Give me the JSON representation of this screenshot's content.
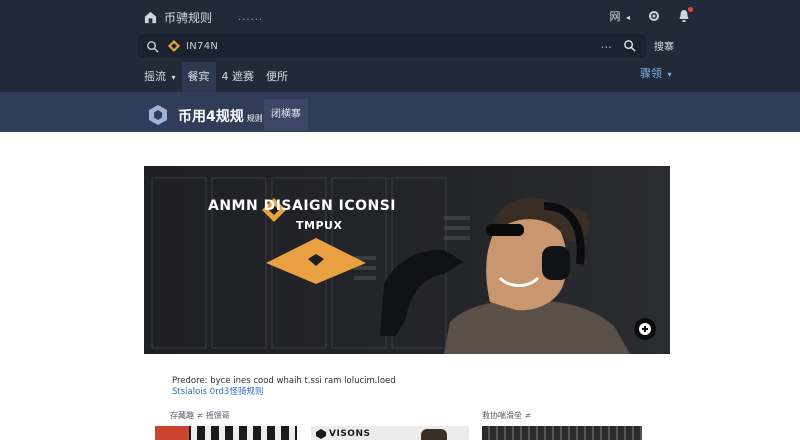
{
  "header": {
    "site_name": "币骋规则",
    "site_dots": "......",
    "lang_label": "网",
    "lang_caret": "◂",
    "search_query": "IN74N",
    "search_dots": "...",
    "search_button": "搜寨"
  },
  "nav": {
    "items": [
      {
        "label": "摇流",
        "caret": "▾"
      },
      {
        "label": "餐宾"
      },
      {
        "label": "4 遮赛"
      },
      {
        "label": "便所"
      }
    ],
    "right_label": "骤领",
    "right_caret": "▾"
  },
  "banner": {
    "title": "币用4规规",
    "subtitle": "规则",
    "button": "闭横寨"
  },
  "hero": {
    "title": "ANMN   DISAIGN ICONSI",
    "subtitle": "TMPUX"
  },
  "desc": {
    "line1": "Predore:  byce ines  cood whaih t.ssi ram lolucim.loed",
    "line2": "Stsialois 0rd3怪骑规则"
  },
  "strip": {
    "label_left": "存藏趣 ≠  摇馈哥",
    "label_right": "救协喘滑垒 ≠"
  },
  "thumbs": {
    "t2_text": "VISONS"
  },
  "colors": {
    "topbar": "#222a3a",
    "banner": "#303d58",
    "accent_orange": "#e8a040",
    "link_blue": "#2f6fbf"
  }
}
